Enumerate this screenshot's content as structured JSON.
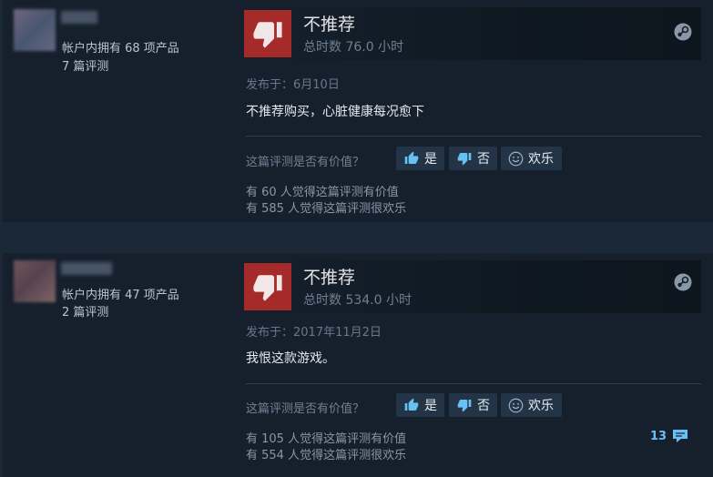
{
  "reviews": [
    {
      "author": {
        "products": "帐户内拥有 68 项产品",
        "reviews": "7 篇评测"
      },
      "recommendation": "不推荐",
      "hours": "总时数 76.0 小时",
      "posted": "发布于：6月10日",
      "text": "不推荐购买，心脏健康每况愈下",
      "helpful_question": "这篇评测是否有价值？",
      "buttons": {
        "yes": "是",
        "no": "否",
        "funny": "欢乐"
      },
      "helpful_line": "有 60 人觉得这篇评测有价值",
      "funny_line": "有 585 人觉得这篇评测很欢乐"
    },
    {
      "author": {
        "products": "帐户内拥有 47 项产品",
        "reviews": "2 篇评测"
      },
      "recommendation": "不推荐",
      "hours": "总时数 534.0 小时",
      "posted": "发布于：2017年11月2日",
      "text": "我恨这款游戏。",
      "helpful_question": "这篇评测是否有价值？",
      "buttons": {
        "yes": "是",
        "no": "否",
        "funny": "欢乐"
      },
      "helpful_line": "有 105 人觉得这篇评测有价值",
      "funny_line": "有 554 人觉得这篇评测很欢乐",
      "comment_count": "13"
    }
  ],
  "colors": {
    "background": "#1b2838",
    "card": "#16202d",
    "thumbs_down": "#a52a2a",
    "link": "#67c1f5"
  },
  "icons": [
    "thumbs-down-icon",
    "steam-logo-icon",
    "thumbs-up-icon",
    "smiley-icon",
    "comment-icon"
  ]
}
